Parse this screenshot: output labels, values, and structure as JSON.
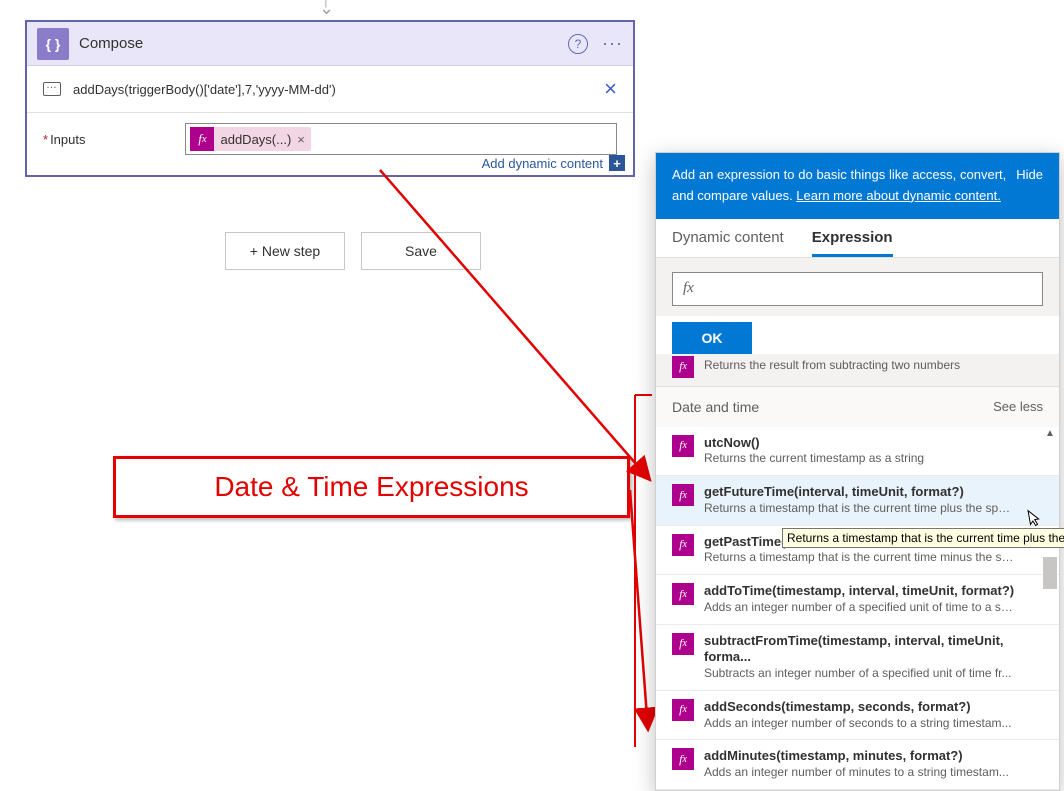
{
  "compose": {
    "title": "Compose",
    "expression_preview": "addDays(triggerBody()['date'],7,'yyyy-MM-dd')",
    "inputs_label": "Inputs",
    "pill": "addDays(...)",
    "add_dynamic": "Add dynamic content"
  },
  "buttons": {
    "new_step": "+ New step",
    "save": "Save"
  },
  "callout": {
    "text": "Date & Time Expressions"
  },
  "panel": {
    "head_text_a": "Add an expression to do basic things like access, convert, and compare values. ",
    "head_link": "Learn more about dynamic content.",
    "hide": "Hide",
    "tabs": {
      "dynamic": "Dynamic content",
      "expression": "Expression"
    },
    "fx_input": "fx",
    "ok": "OK",
    "prev_desc": "Returns the result from subtracting two numbers",
    "section": {
      "title": "Date and time",
      "less": "See less"
    },
    "functions": [
      {
        "name": "utcNow()",
        "desc": "Returns the current timestamp as a string"
      },
      {
        "name": "getFutureTime(interval, timeUnit, format?)",
        "desc": "Returns a timestamp that is the current time plus the spe..."
      },
      {
        "name": "getPastTime(in",
        "desc": "Returns a timestamp that is the current time minus the sp..."
      },
      {
        "name": "addToTime(timestamp, interval, timeUnit, format?)",
        "desc": "Adds an integer number of a specified unit of time to a st..."
      },
      {
        "name": "subtractFromTime(timestamp, interval, timeUnit, forma...",
        "desc": "Subtracts an integer number of a specified unit of time fr..."
      },
      {
        "name": "addSeconds(timestamp, seconds, format?)",
        "desc": "Adds an integer number of seconds to a string timestam..."
      },
      {
        "name": "addMinutes(timestamp, minutes, format?)",
        "desc": "Adds an integer number of minutes to a string timestam..."
      }
    ],
    "tooltip": "Returns a timestamp that is the current time plus the"
  }
}
